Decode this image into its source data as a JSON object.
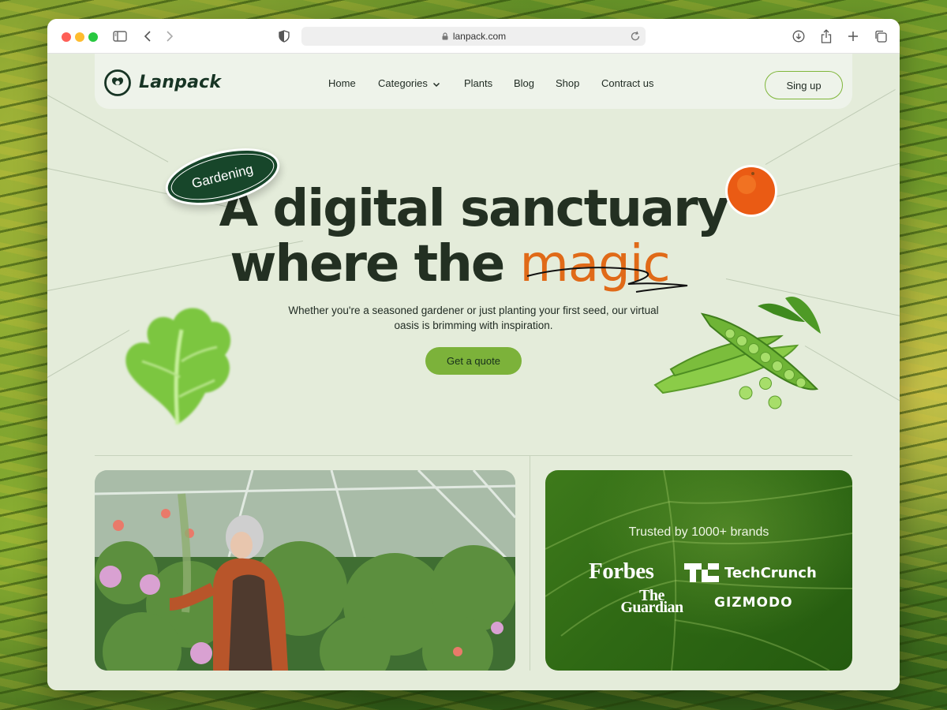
{
  "browser": {
    "url": "lanpack.com"
  },
  "brand": {
    "name": "Lanpack"
  },
  "nav": {
    "items": [
      "Home",
      "Categories",
      "Plants",
      "Blog",
      "Shop",
      "Contract us"
    ],
    "signup_label": "Sing up"
  },
  "hero": {
    "tag": "Gardening",
    "line1": "A digital sanctuary",
    "line2_prefix": "where the",
    "line2_accent": "magic",
    "subtext": "Whether you're a seasoned gardener or just planting your first seed, our virtual oasis is brimming with inspiration.",
    "cta_label": "Get a quote"
  },
  "trusted": {
    "title": "Trusted by 1000+ brands",
    "brands": [
      "Forbes",
      "TechCrunch",
      "The Guardian",
      "GIZMODO"
    ]
  },
  "colors": {
    "accent": "#7cb23a",
    "brand_dark": "#17462a",
    "magic": "#e06a18"
  }
}
